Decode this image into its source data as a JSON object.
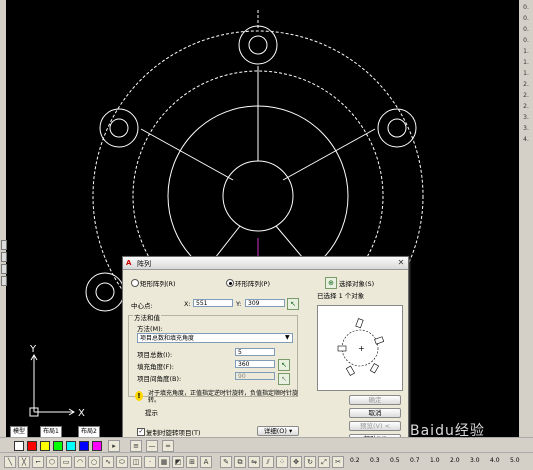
{
  "dialog": {
    "title": "阵列",
    "radio_rect": "矩形阵列(R)",
    "radio_polar": "环形阵列(P)",
    "select_objects_btn": "选择对象(S)",
    "selected_count": "已选择 1 个对象",
    "center_label": "中心点:",
    "x_label": "X:",
    "x_value": "551",
    "y_label": "Y:",
    "y_value": "309",
    "method_group": "方法和值",
    "method_label": "方法(M):",
    "method_value": "项目总数和填充角度",
    "total_items_label": "项目总数(I):",
    "total_items_value": "5",
    "fill_angle_label": "填充角度(F):",
    "fill_angle_value": "360",
    "item_angle_label": "项目间角度(B):",
    "item_angle_value": "90",
    "tip_text": "对于填充角度，正值指定逆时针旋转，负值指定顺时针旋转。",
    "tip_label": "提示",
    "rotate_check": "复制时旋转项目(T)",
    "more_btn": "详细(O) ▾",
    "ok_btn": "确定",
    "cancel_btn": "取消",
    "preview_btn": "预览(V) <",
    "help_btn": "帮助(H)"
  },
  "ucs": {
    "y": "Y",
    "x": "X"
  },
  "tabs": [
    "模型",
    "布局1",
    "布局2"
  ],
  "toolbar2_numbers": [
    "0.2",
    "0.3",
    "0.5",
    "0.7",
    "1.0",
    "2.0",
    "3.0",
    "4.0",
    "5.0"
  ],
  "right_labels": [
    "0.",
    "0.",
    "0.",
    "0.",
    "1.",
    "1.",
    "1.",
    "2.",
    "2.",
    "2.",
    "3.",
    "3.",
    "4."
  ],
  "watermark": "Baidu经验",
  "colors": {
    "background": "#000000",
    "lines": "#ffffff",
    "dialog": "#ece9d8",
    "magenta_line": "#cc33cc"
  }
}
